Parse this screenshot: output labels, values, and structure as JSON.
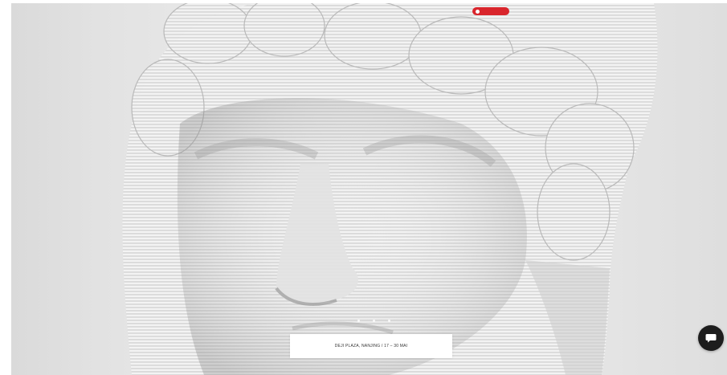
{
  "hero": {
    "image_subject": "sculpted classical head with horizontal ridged layers"
  },
  "top_badge": {
    "label": "",
    "color": "#d9252c"
  },
  "carousel": {
    "dots_count": 3
  },
  "info_card": {
    "text": "DEJI PLAZA, NANJING / 17 – 30 MAI"
  },
  "chat": {
    "icon": "chat-bubble-icon",
    "color": "#1d1d1d"
  }
}
